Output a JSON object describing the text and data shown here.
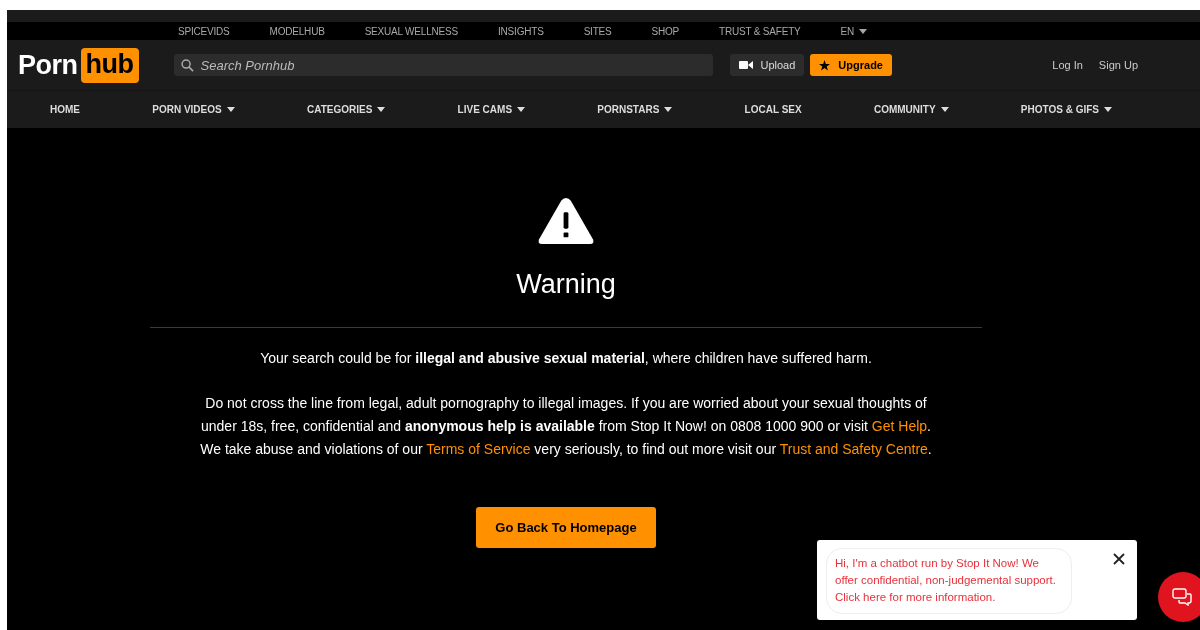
{
  "top_links": [
    {
      "label": "SPICEVIDS",
      "dropdown": false
    },
    {
      "label": "MODELHUB",
      "dropdown": false
    },
    {
      "label": "SEXUAL WELLNESS",
      "dropdown": false
    },
    {
      "label": "INSIGHTS",
      "dropdown": false
    },
    {
      "label": "SITES",
      "dropdown": false
    },
    {
      "label": "SHOP",
      "dropdown": false
    },
    {
      "label": "TRUST & SAFETY",
      "dropdown": false
    },
    {
      "label": "EN",
      "dropdown": true
    }
  ],
  "header": {
    "logo": {
      "first": "Porn",
      "second": "hub"
    },
    "search": {
      "placeholder": "Search Pornhub"
    },
    "buttons": [
      {
        "label": "Upload",
        "kind": "upload"
      },
      {
        "label": "Upgrade",
        "kind": "upgrade"
      }
    ],
    "account_links": [
      "Log In",
      "Sign Up"
    ]
  },
  "nav": [
    {
      "label": "HOME",
      "dropdown": false
    },
    {
      "label": "PORN VIDEOS",
      "dropdown": true
    },
    {
      "label": "CATEGORIES",
      "dropdown": true
    },
    {
      "label": "LIVE CAMS",
      "dropdown": true
    },
    {
      "label": "PORNSTARS",
      "dropdown": true
    },
    {
      "label": "LOCAL SEX",
      "dropdown": false
    },
    {
      "label": "COMMUNITY",
      "dropdown": true
    },
    {
      "label": "PHOTOS & GIFS",
      "dropdown": true
    }
  ],
  "warning": {
    "title": "Warning",
    "message": "Your search could be for **illegal and abusive sexual material**, where children have suffered harm.",
    "lines": [
      [
        {
          "kind": "text",
          "text": "Do not cross the line from legal, adult pornography to illegal images. If you are worried about your sexual thoughts of"
        }
      ],
      [
        {
          "kind": "text",
          "text": "under 18s, free, confidential and **anonymous help is available** from Stop It Now! on 0808 1000 900 or visit "
        },
        {
          "kind": "link",
          "text": "Get Help"
        },
        {
          "kind": "text",
          "text": "."
        }
      ],
      [
        {
          "kind": "text",
          "text": "We take abuse and violations of our "
        },
        {
          "kind": "link",
          "text": "Terms of Service"
        },
        {
          "kind": "text",
          "text": " very seriously, to find out more visit our "
        },
        {
          "kind": "link",
          "text": "Trust and Safety Centre"
        },
        {
          "kind": "text",
          "text": "."
        }
      ]
    ],
    "button": "Go Back To Homepage"
  },
  "chat_popup": {
    "message": "Hi, I'm a chatbot run by Stop It Now! We offer confidential, non-judgemental support. Click here for more information."
  }
}
